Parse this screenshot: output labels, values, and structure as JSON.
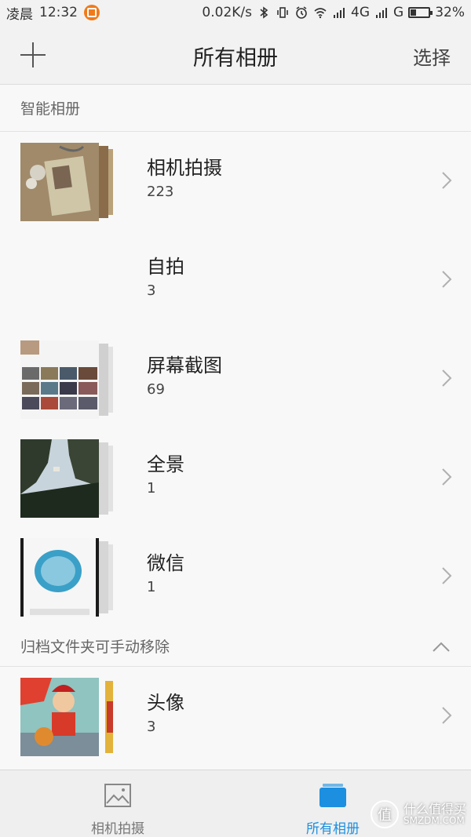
{
  "status_bar": {
    "time_prefix": "凌晨",
    "time": "12:32",
    "speed": "0.02K/s",
    "network1": "4G",
    "network2": "G",
    "battery": "32%",
    "battery_level": 0.32
  },
  "title_bar": {
    "title": "所有相册",
    "select_label": "选择"
  },
  "sections": {
    "smart_albums": "智能相册",
    "archive": "归档文件夹可手动移除"
  },
  "albums": [
    {
      "name": "相机拍摄",
      "count": "223"
    },
    {
      "name": "自拍",
      "count": "3"
    },
    {
      "name": "屏幕截图",
      "count": "69"
    },
    {
      "name": "全景",
      "count": "1"
    },
    {
      "name": "微信",
      "count": "1"
    },
    {
      "name": "头像",
      "count": "3"
    }
  ],
  "bottom_nav": {
    "camera_label": "相机拍摄",
    "albums_label": "所有相册"
  },
  "watermark": {
    "logo_char": "值",
    "text_top": "什么值得买",
    "text_bottom": "SMZDM.COM"
  },
  "colors": {
    "accent": "#1c8fe0",
    "notification": "#f07a1a"
  }
}
